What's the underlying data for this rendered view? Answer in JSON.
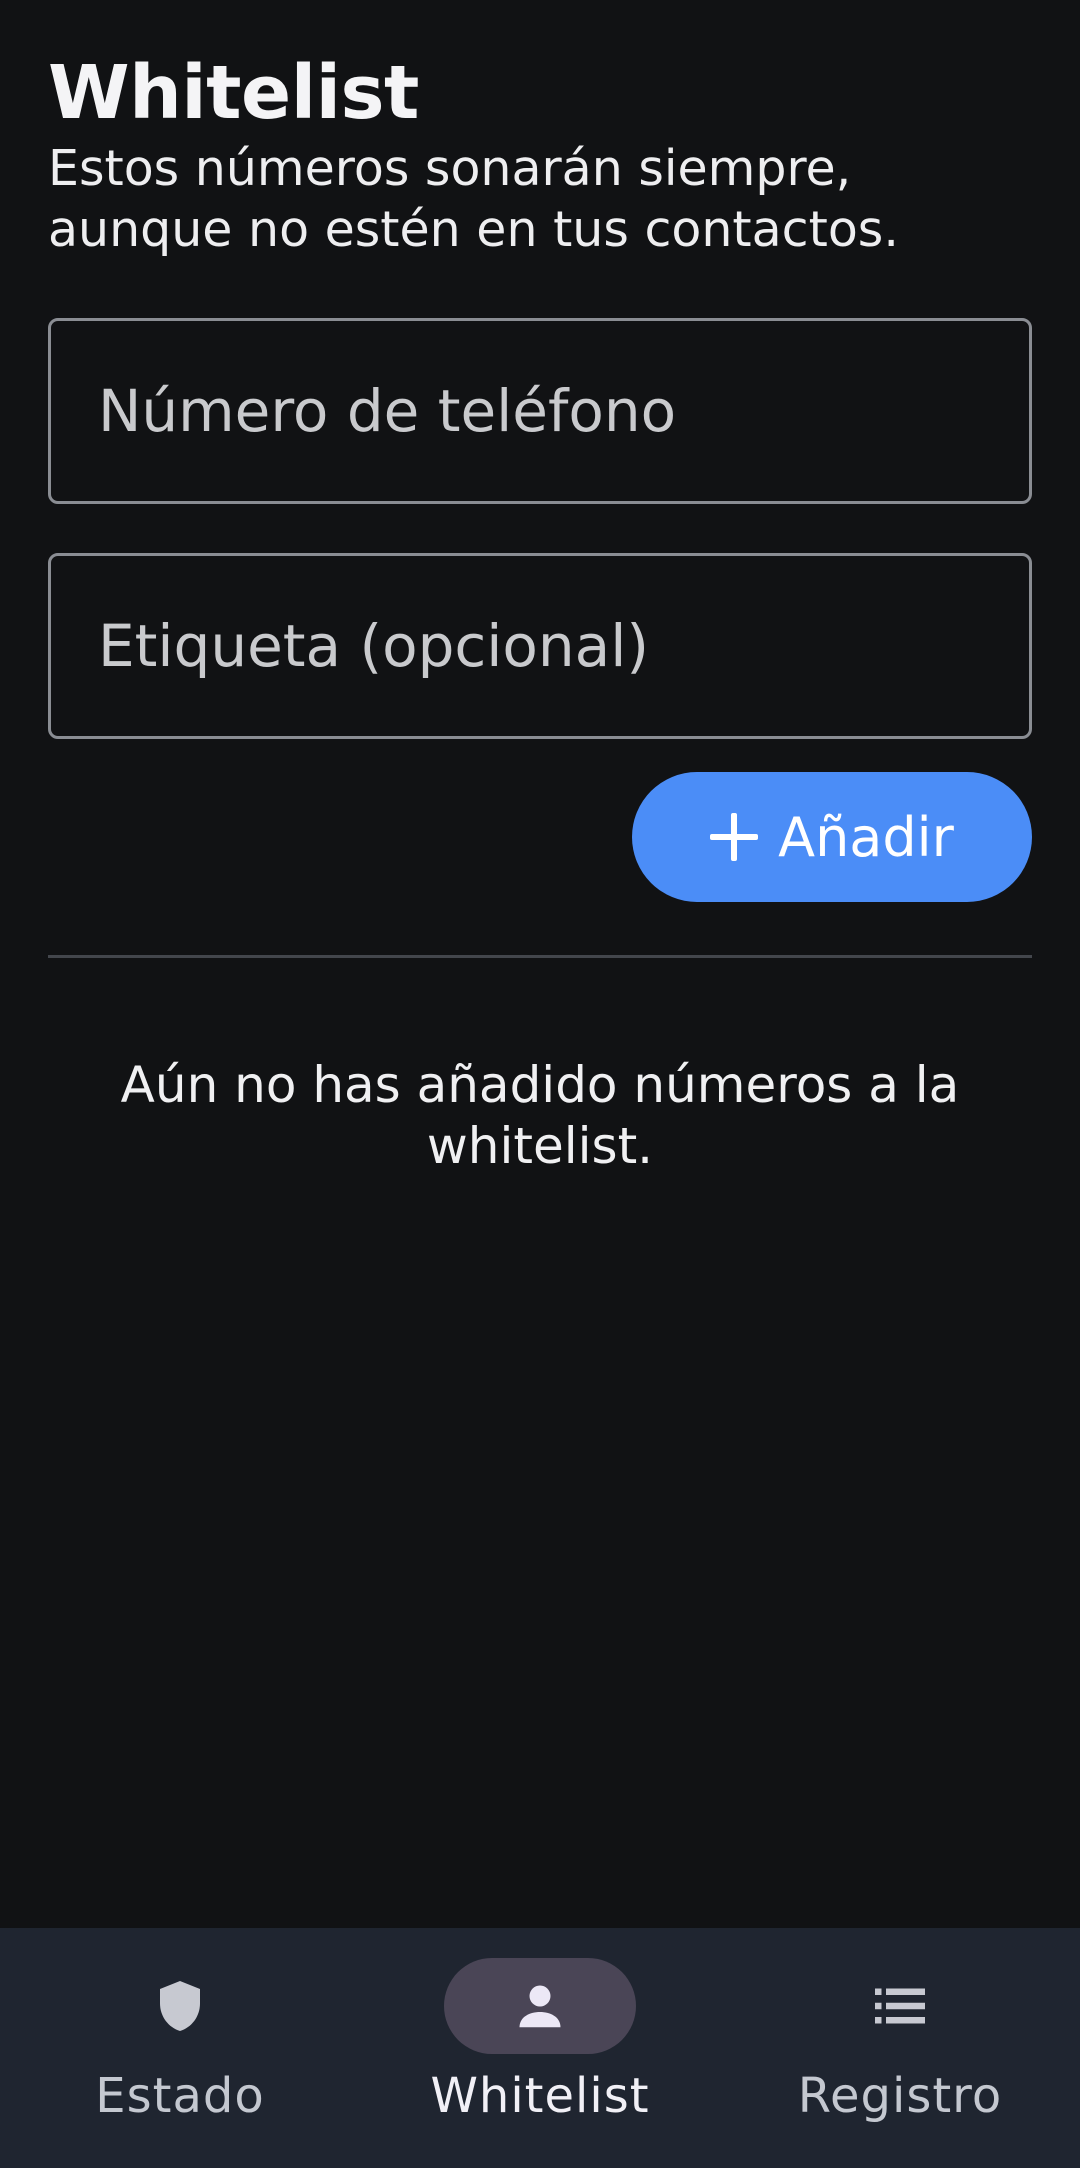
{
  "screen": {
    "title": "Whitelist",
    "subtitle": "Estos números sonarán siempre, aunque no estén en tus contactos."
  },
  "form": {
    "phone_placeholder": "Número de teléfono",
    "phone_value": "",
    "label_placeholder": "Etiqueta (opcional)",
    "label_value": "",
    "add_button_label": "Añadir",
    "add_button_icon": "plus-icon"
  },
  "empty_state": {
    "message": "Aún no has añadido números a la whitelist."
  },
  "bottom_nav": {
    "selected": "Whitelist",
    "items": [
      {
        "label": "Estado",
        "icon": "shield-icon"
      },
      {
        "label": "Whitelist",
        "icon": "person-icon"
      },
      {
        "label": "Registro",
        "icon": "list-icon"
      }
    ]
  },
  "colors": {
    "background": "#111214",
    "accent": "#4b8df7",
    "nav_background": "#1f2530",
    "nav_selected_pill": "#4a4556",
    "field_border": "#8a8d93"
  }
}
